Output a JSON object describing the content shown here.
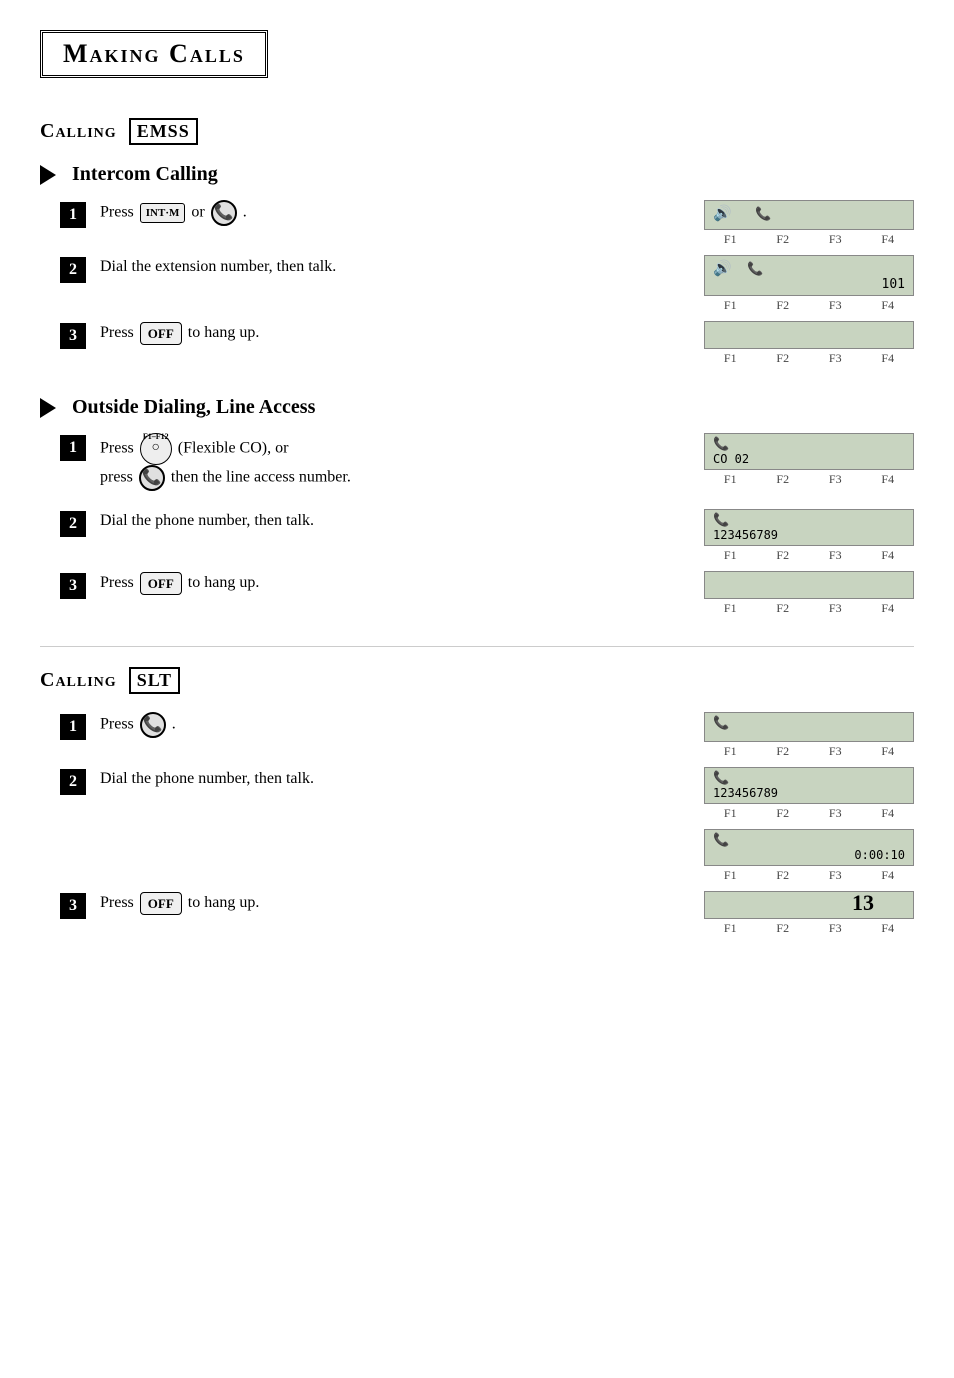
{
  "page": {
    "title": "Making Calls",
    "number": "13"
  },
  "calling_emss": {
    "label": "Calling",
    "badge": "EMSS"
  },
  "intercom": {
    "heading": "Intercom Calling",
    "steps": [
      {
        "num": "1",
        "text_prefix": "Press",
        "button1": "INT·M",
        "or_text": "or",
        "has_phone_btn": true,
        "display_icons": "🔊  📞",
        "display_labels": [
          "F1",
          "F2",
          "F3",
          "F4"
        ]
      },
      {
        "num": "2",
        "text": "Dial the extension number, then talk.",
        "display_line1": "🔊  📞",
        "display_line2": "101",
        "display_labels": [
          "F1",
          "F2",
          "F3",
          "F4"
        ]
      },
      {
        "num": "3",
        "text_prefix": "Press",
        "button": "OFF",
        "text_suffix": "to hang up.",
        "display_labels": [
          "F1",
          "F2",
          "F3",
          "F4"
        ]
      }
    ]
  },
  "outside_dialing": {
    "heading": "Outside Dialing, Line Access",
    "steps": [
      {
        "num": "1",
        "text_prefix": "Press",
        "button_label": "F1–F12 (Flexible CO), or",
        "sub_text": "press",
        "sub_suffix": "then the line access number.",
        "display_line1": "📞",
        "display_line2": "CO 02",
        "display_labels": [
          "F1",
          "F2",
          "F3",
          "F4"
        ]
      },
      {
        "num": "2",
        "text": "Dial the phone number, then talk.",
        "display_line1": "📞",
        "display_line2": "123456789",
        "display_labels": [
          "F1",
          "F2",
          "F3",
          "F4"
        ]
      },
      {
        "num": "3",
        "text_prefix": "Press",
        "button": "OFF",
        "text_suffix": "to hang up.",
        "display_labels": [
          "F1",
          "F2",
          "F3",
          "F4"
        ]
      }
    ]
  },
  "calling_slt": {
    "label": "Calling",
    "badge": "SLT",
    "steps": [
      {
        "num": "1",
        "text_prefix": "Press",
        "has_phone_btn": true,
        "display_line1": "📞",
        "display_labels": [
          "F1",
          "F2",
          "F3",
          "F4"
        ]
      },
      {
        "num": "2",
        "text": "Dial the phone number, then talk.",
        "display_line1": "📞",
        "display_line2": "123456789",
        "display_labels_a": [
          "F1",
          "F2",
          "F3",
          "F4"
        ],
        "display_line3": "📞",
        "display_line4": "0:00:10",
        "display_labels_b": [
          "F1",
          "F2",
          "F3",
          "F4"
        ]
      },
      {
        "num": "3",
        "text_prefix": "Press",
        "button": "OFF",
        "text_suffix": "to hang up.",
        "display_labels": [
          "F1",
          "F2",
          "F3",
          "F4"
        ]
      }
    ]
  }
}
